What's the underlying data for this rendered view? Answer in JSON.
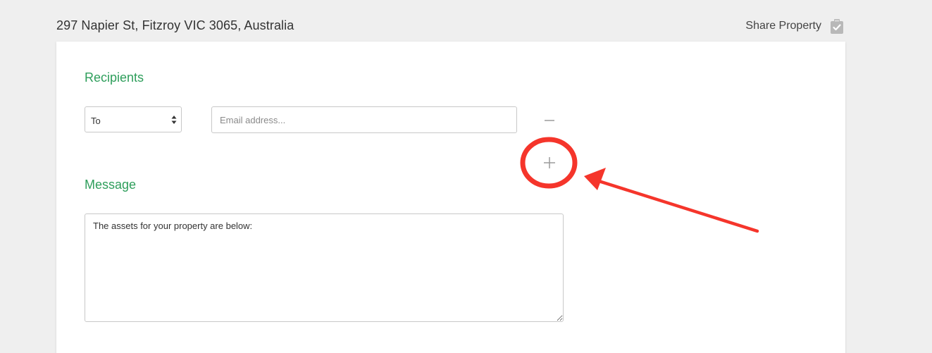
{
  "header": {
    "address": "297 Napier St, Fitzroy VIC 3065, Australia",
    "share_label": "Share Property",
    "share_icon": "clipboard-check-icon"
  },
  "recipients": {
    "title": "Recipients",
    "type_select": {
      "selected": "To"
    },
    "email": {
      "value": "",
      "placeholder": "Email address..."
    },
    "remove_icon": "minus-icon",
    "add_icon": "plus-icon"
  },
  "message": {
    "title": "Message",
    "body": "The assets for your property are below:"
  },
  "annotation": {
    "color": "#f5352b",
    "shapes": [
      "highlight-circle",
      "pointer-arrow"
    ]
  },
  "colors": {
    "accent_green": "#2e9e5b",
    "background": "#efefef",
    "card": "#ffffff"
  }
}
